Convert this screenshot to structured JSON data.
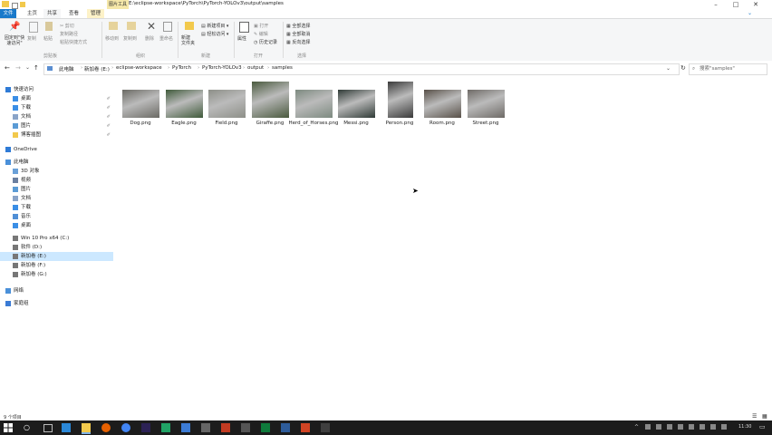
{
  "window": {
    "context_tab": "图片工具",
    "title": "E:\\eclipse-workspace\\PyTorch\\PyTorch-YOLOv3\\output\\samples"
  },
  "ribbon_tabs": [
    "文件",
    "主页",
    "共享",
    "查看",
    "管理"
  ],
  "ribbon": {
    "pin_quick": "固定到\"快速访问\"",
    "copy": "复制",
    "paste": "粘贴",
    "cut": "剪切",
    "copy_path": "复制路径",
    "paste_shortcut": "粘贴快捷方式",
    "move_to": "移动到",
    "copy_to": "复制到",
    "delete": "删除",
    "rename": "重命名",
    "new_folder": "新建\n文件夹",
    "new_item": "新建项目",
    "easy_access": "轻松访问",
    "properties": "属性",
    "open": "打开",
    "edit": "编辑",
    "history": "历史记录",
    "select_all": "全部选择",
    "select_none": "全部取消",
    "invert": "反向选择",
    "group_clipboard": "剪贴板",
    "group_organize": "组织",
    "group_new": "新建",
    "group_open": "打开",
    "group_select": "选择"
  },
  "breadcrumb": [
    "此电脑",
    "新加卷 (E:)",
    "eclipse-workspace",
    "PyTorch",
    "PyTorch-YOLOv3",
    "output",
    "samples"
  ],
  "search_placeholder": "搜索\"samples\"",
  "sidebar": {
    "items": [
      {
        "label": "快速访问",
        "level": 0,
        "icon": "star-icon"
      },
      {
        "label": "桌面",
        "level": 1,
        "icon": "desktop-icon",
        "pinned": true
      },
      {
        "label": "下载",
        "level": 1,
        "icon": "download-icon",
        "pinned": true
      },
      {
        "label": "文档",
        "level": 1,
        "icon": "document-icon",
        "pinned": true
      },
      {
        "label": "图片",
        "level": 1,
        "icon": "picture-icon",
        "pinned": true
      },
      {
        "label": "博客插图",
        "level": 1,
        "icon": "folder-icon",
        "pinned": true
      },
      {
        "label": "OneDrive",
        "level": 0,
        "icon": "cloud-icon"
      },
      {
        "label": "此电脑",
        "level": 0,
        "icon": "computer-icon"
      },
      {
        "label": "3D 对象",
        "level": 1,
        "icon": "cube-icon"
      },
      {
        "label": "视频",
        "level": 1,
        "icon": "video-icon"
      },
      {
        "label": "图片",
        "level": 1,
        "icon": "picture-icon"
      },
      {
        "label": "文档",
        "level": 1,
        "icon": "document-icon"
      },
      {
        "label": "下载",
        "level": 1,
        "icon": "download-icon"
      },
      {
        "label": "音乐",
        "level": 1,
        "icon": "music-icon"
      },
      {
        "label": "桌面",
        "level": 1,
        "icon": "desktop-icon"
      },
      {
        "label": "Win 10 Pro x64 (C:)",
        "level": 1,
        "icon": "drive-icon"
      },
      {
        "label": "软件 (D:)",
        "level": 1,
        "icon": "drive-icon"
      },
      {
        "label": "新加卷 (E:)",
        "level": 1,
        "icon": "drive-icon",
        "selected": true
      },
      {
        "label": "新加卷 (F:)",
        "level": 1,
        "icon": "drive-icon"
      },
      {
        "label": "新加卷 (G:)",
        "level": 1,
        "icon": "drive-icon"
      },
      {
        "label": "网络",
        "level": 0,
        "icon": "network-icon"
      },
      {
        "label": "家庭组",
        "level": 0,
        "icon": "homegroup-icon"
      }
    ]
  },
  "files": [
    {
      "name": "Dog.png",
      "color": "#6b6a64"
    },
    {
      "name": "Eagle.png",
      "color": "#3f5a3a"
    },
    {
      "name": "Field.png",
      "color": "#8d8f88"
    },
    {
      "name": "Giraffe.png",
      "color": "#4a5a3e"
    },
    {
      "name": "Herd_of_Horses.png",
      "color": "#7d8a80"
    },
    {
      "name": "Messi.png",
      "color": "#2f3a36"
    },
    {
      "name": "Person.png",
      "color": "#3a3a3a"
    },
    {
      "name": "Room.png",
      "color": "#585048"
    },
    {
      "name": "Street.png",
      "color": "#6e6a66"
    }
  ],
  "status": "9 个项目",
  "taskbar": {
    "time": "11:30"
  },
  "accent": "#1979ca"
}
